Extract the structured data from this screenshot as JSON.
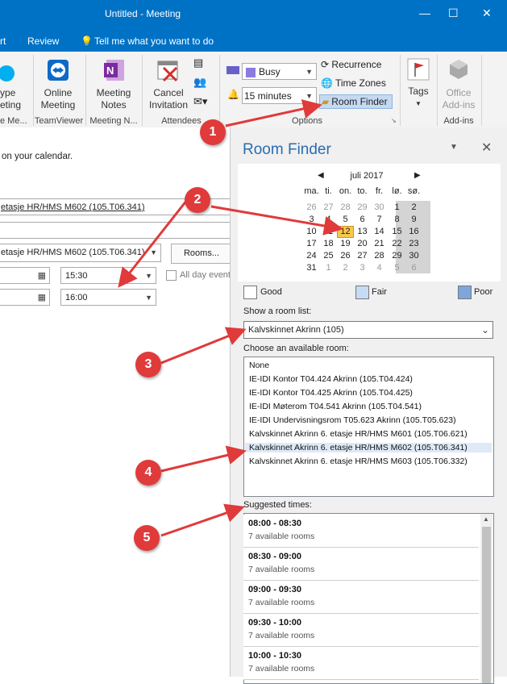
{
  "window": {
    "title": "Untitled  -  Meeting"
  },
  "tabs": [
    "rt",
    "Review",
    "Tell me what you want to do"
  ],
  "ribbon": {
    "skype": [
      "ype",
      "eting",
      "e Me..."
    ],
    "online_meeting": [
      "Online",
      "Meeting"
    ],
    "teamviewer_group": "TeamViewer",
    "meeting_notes": [
      "Meeting",
      "Notes"
    ],
    "meeting_n_group": "Meeting N...",
    "cancel_invitation": [
      "Cancel",
      "Invitation"
    ],
    "attendees_group": "Attendees",
    "show_as": "Busy",
    "reminder": "15 minutes",
    "recurrence": "Recurrence",
    "time_zones": "Time Zones",
    "room_finder": "Room Finder",
    "options_group": "Options",
    "tags": "Tags",
    "office_addins": [
      "Office",
      "Add-ins"
    ],
    "addins_group": "Add-ins"
  },
  "form": {
    "notice": "on your calendar.",
    "location_link": "etasje HR/HMS M602 (105.T06.341)",
    "location_select": "etasje HR/HMS M602 (105.T06.341)",
    "rooms_button": "Rooms...",
    "start_time": "15:30",
    "end_time": "16:00",
    "all_day": "All day event"
  },
  "room_finder": {
    "title": "Room Finder",
    "month": "juli 2017",
    "weekdays": [
      "ma.",
      "ti.",
      "on.",
      "to.",
      "fr.",
      "lø.",
      "sø."
    ],
    "weeks": [
      [
        "26",
        "27",
        "28",
        "29",
        "30",
        "1",
        "2"
      ],
      [
        "3",
        "4",
        "5",
        "6",
        "7",
        "8",
        "9"
      ],
      [
        "10",
        "11",
        "12",
        "13",
        "14",
        "15",
        "16"
      ],
      [
        "17",
        "18",
        "19",
        "20",
        "21",
        "22",
        "23"
      ],
      [
        "24",
        "25",
        "26",
        "27",
        "28",
        "29",
        "30"
      ],
      [
        "31",
        "1",
        "2",
        "3",
        "4",
        "5",
        "6"
      ]
    ],
    "selected_day": "12",
    "legend": {
      "good": "Good",
      "fair": "Fair",
      "poor": "Poor"
    },
    "room_list_label": "Show a room list:",
    "room_list_value": "Kalvskinnet Akrinn (105)",
    "choose_label": "Choose an available room:",
    "rooms": [
      "None",
      "IE-IDI Kontor T04.424 Akrinn (105.T04.424)",
      "IE-IDI Kontor T04.425 Akrinn (105.T04.425)",
      "IE-IDI Møterom T04.541 Akrinn (105.T04.541)",
      "IE-IDI Undervisningsrom T05.623 Akrinn (105.T05.623)",
      "Kalvskinnet Akrinn 6. etasje HR/HMS M601 (105.T06.621)",
      "Kalvskinnet Akrinn 6. etasje HR/HMS M602 (105.T06.341)",
      "Kalvskinnet Akrinn 6. etasje HR/HMS M603 (105.T06.332)"
    ],
    "selected_room_index": 6,
    "suggested_label": "Suggested times:",
    "slots": [
      {
        "time": "08:00 - 08:30",
        "rooms": "7 available rooms"
      },
      {
        "time": "08:30 - 09:00",
        "rooms": "7 available rooms"
      },
      {
        "time": "09:00 - 09:30",
        "rooms": "7 available rooms"
      },
      {
        "time": "09:30 - 10:00",
        "rooms": "7 available rooms"
      },
      {
        "time": "10:00 - 10:30",
        "rooms": "7 available rooms"
      }
    ]
  },
  "callouts": [
    "1",
    "2",
    "3",
    "4",
    "5"
  ],
  "colors": {
    "accent": "#0072c6",
    "callout": "#e03a3a",
    "selected_day": "#f7c84a",
    "poor": "#7ea6dd",
    "fair": "#c6dcf5"
  }
}
